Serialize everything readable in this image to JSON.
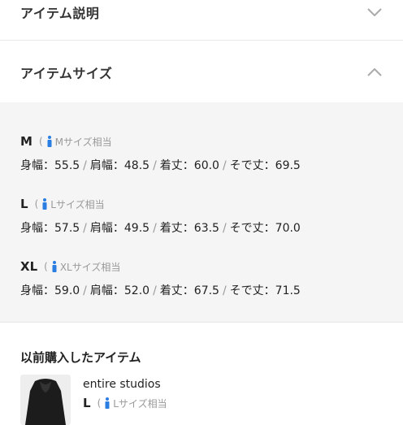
{
  "accordion": {
    "description_title": "アイテム説明",
    "size_title": "アイテムサイズ"
  },
  "sizes": [
    {
      "name": "M",
      "paren": "(",
      "fit_label": "Mサイズ相当",
      "measurements": [
        "身幅：55.5",
        "肩幅：48.5",
        "着丈：60.0",
        "そで丈：69.5"
      ]
    },
    {
      "name": "L",
      "paren": "(",
      "fit_label": "Lサイズ相当",
      "measurements": [
        "身幅：57.5",
        "肩幅：49.5",
        "着丈：63.5",
        "そで丈：70.0"
      ]
    },
    {
      "name": "XL",
      "paren": "(",
      "fit_label": "XLサイズ相当",
      "measurements": [
        "身幅：59.0",
        "肩幅：52.0",
        "着丈：67.5",
        "そで丈：71.5"
      ]
    }
  ],
  "separator": "/",
  "previous_purchases": {
    "title": "以前購入したアイテム",
    "items": [
      {
        "brand": "entire studios",
        "size": "L",
        "paren": "(",
        "fit_label": "Lサイズ相当"
      }
    ]
  },
  "colors": {
    "panel_bg": "#f5f5f5",
    "person_icon": "#2a7de1",
    "muted_text": "#999999"
  },
  "icons": {
    "collapsed": "chevron-down-icon",
    "expanded": "chevron-up-icon",
    "fit": "person-icon"
  }
}
